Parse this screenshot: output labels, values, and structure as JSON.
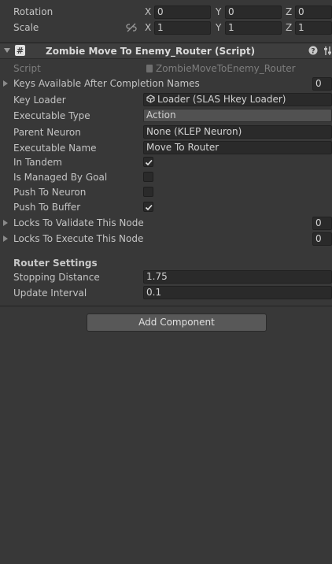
{
  "transform": {
    "rotation": {
      "label": "Rotation",
      "x_axis": "X",
      "x": "0",
      "y_axis": "Y",
      "y": "0",
      "z_axis": "Z",
      "z": "0"
    },
    "scale": {
      "label": "Scale",
      "x_axis": "X",
      "x": "1",
      "y_axis": "Y",
      "y": "1",
      "z_axis": "Z",
      "z": "1"
    }
  },
  "component": {
    "title": "Zombie Move To Enemy_Router (Script)",
    "script_label": "Script",
    "script_value": "ZombieMoveToEnemy_Router",
    "keys_label": "Keys Available After Completion Names",
    "keys_count": "0",
    "key_loader_label": "Key Loader",
    "key_loader_value": "Loader (SLAS Hkey Loader)",
    "executable_type_label": "Executable Type",
    "executable_type_value": "Action",
    "parent_neuron_label": "Parent Neuron",
    "parent_neuron_value": "None (KLEP Neuron)",
    "executable_name_label": "Executable Name",
    "executable_name_value": "Move To Router",
    "in_tandem_label": "In Tandem",
    "is_managed_label": "Is Managed By Goal",
    "push_neuron_label": "Push To Neuron",
    "push_buffer_label": "Push To Buffer",
    "locks_validate_label": "Locks To Validate This Node",
    "locks_validate_count": "0",
    "locks_execute_label": "Locks To Execute This Node",
    "locks_execute_count": "0",
    "router_settings_label": "Router Settings",
    "stopping_distance_label": "Stopping Distance",
    "stopping_distance_value": "1.75",
    "update_interval_label": "Update Interval",
    "update_interval_value": "0.1"
  },
  "add_component_label": "Add Component"
}
